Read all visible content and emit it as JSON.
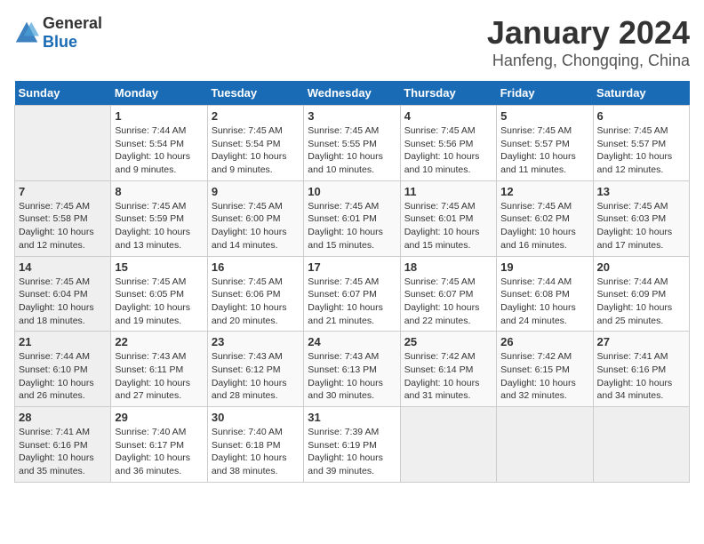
{
  "header": {
    "logo_general": "General",
    "logo_blue": "Blue",
    "month_year": "January 2024",
    "location": "Hanfeng, Chongqing, China"
  },
  "calendar": {
    "days_of_week": [
      "Sunday",
      "Monday",
      "Tuesday",
      "Wednesday",
      "Thursday",
      "Friday",
      "Saturday"
    ],
    "weeks": [
      [
        {
          "day": "",
          "info": ""
        },
        {
          "day": "1",
          "info": "Sunrise: 7:44 AM\nSunset: 5:54 PM\nDaylight: 10 hours\nand 9 minutes."
        },
        {
          "day": "2",
          "info": "Sunrise: 7:45 AM\nSunset: 5:54 PM\nDaylight: 10 hours\nand 9 minutes."
        },
        {
          "day": "3",
          "info": "Sunrise: 7:45 AM\nSunset: 5:55 PM\nDaylight: 10 hours\nand 10 minutes."
        },
        {
          "day": "4",
          "info": "Sunrise: 7:45 AM\nSunset: 5:56 PM\nDaylight: 10 hours\nand 10 minutes."
        },
        {
          "day": "5",
          "info": "Sunrise: 7:45 AM\nSunset: 5:57 PM\nDaylight: 10 hours\nand 11 minutes."
        },
        {
          "day": "6",
          "info": "Sunrise: 7:45 AM\nSunset: 5:57 PM\nDaylight: 10 hours\nand 12 minutes."
        }
      ],
      [
        {
          "day": "7",
          "info": "Sunrise: 7:45 AM\nSunset: 5:58 PM\nDaylight: 10 hours\nand 12 minutes."
        },
        {
          "day": "8",
          "info": "Sunrise: 7:45 AM\nSunset: 5:59 PM\nDaylight: 10 hours\nand 13 minutes."
        },
        {
          "day": "9",
          "info": "Sunrise: 7:45 AM\nSunset: 6:00 PM\nDaylight: 10 hours\nand 14 minutes."
        },
        {
          "day": "10",
          "info": "Sunrise: 7:45 AM\nSunset: 6:01 PM\nDaylight: 10 hours\nand 15 minutes."
        },
        {
          "day": "11",
          "info": "Sunrise: 7:45 AM\nSunset: 6:01 PM\nDaylight: 10 hours\nand 15 minutes."
        },
        {
          "day": "12",
          "info": "Sunrise: 7:45 AM\nSunset: 6:02 PM\nDaylight: 10 hours\nand 16 minutes."
        },
        {
          "day": "13",
          "info": "Sunrise: 7:45 AM\nSunset: 6:03 PM\nDaylight: 10 hours\nand 17 minutes."
        }
      ],
      [
        {
          "day": "14",
          "info": "Sunrise: 7:45 AM\nSunset: 6:04 PM\nDaylight: 10 hours\nand 18 minutes."
        },
        {
          "day": "15",
          "info": "Sunrise: 7:45 AM\nSunset: 6:05 PM\nDaylight: 10 hours\nand 19 minutes."
        },
        {
          "day": "16",
          "info": "Sunrise: 7:45 AM\nSunset: 6:06 PM\nDaylight: 10 hours\nand 20 minutes."
        },
        {
          "day": "17",
          "info": "Sunrise: 7:45 AM\nSunset: 6:07 PM\nDaylight: 10 hours\nand 21 minutes."
        },
        {
          "day": "18",
          "info": "Sunrise: 7:45 AM\nSunset: 6:07 PM\nDaylight: 10 hours\nand 22 minutes."
        },
        {
          "day": "19",
          "info": "Sunrise: 7:44 AM\nSunset: 6:08 PM\nDaylight: 10 hours\nand 24 minutes."
        },
        {
          "day": "20",
          "info": "Sunrise: 7:44 AM\nSunset: 6:09 PM\nDaylight: 10 hours\nand 25 minutes."
        }
      ],
      [
        {
          "day": "21",
          "info": "Sunrise: 7:44 AM\nSunset: 6:10 PM\nDaylight: 10 hours\nand 26 minutes."
        },
        {
          "day": "22",
          "info": "Sunrise: 7:43 AM\nSunset: 6:11 PM\nDaylight: 10 hours\nand 27 minutes."
        },
        {
          "day": "23",
          "info": "Sunrise: 7:43 AM\nSunset: 6:12 PM\nDaylight: 10 hours\nand 28 minutes."
        },
        {
          "day": "24",
          "info": "Sunrise: 7:43 AM\nSunset: 6:13 PM\nDaylight: 10 hours\nand 30 minutes."
        },
        {
          "day": "25",
          "info": "Sunrise: 7:42 AM\nSunset: 6:14 PM\nDaylight: 10 hours\nand 31 minutes."
        },
        {
          "day": "26",
          "info": "Sunrise: 7:42 AM\nSunset: 6:15 PM\nDaylight: 10 hours\nand 32 minutes."
        },
        {
          "day": "27",
          "info": "Sunrise: 7:41 AM\nSunset: 6:16 PM\nDaylight: 10 hours\nand 34 minutes."
        }
      ],
      [
        {
          "day": "28",
          "info": "Sunrise: 7:41 AM\nSunset: 6:16 PM\nDaylight: 10 hours\nand 35 minutes."
        },
        {
          "day": "29",
          "info": "Sunrise: 7:40 AM\nSunset: 6:17 PM\nDaylight: 10 hours\nand 36 minutes."
        },
        {
          "day": "30",
          "info": "Sunrise: 7:40 AM\nSunset: 6:18 PM\nDaylight: 10 hours\nand 38 minutes."
        },
        {
          "day": "31",
          "info": "Sunrise: 7:39 AM\nSunset: 6:19 PM\nDaylight: 10 hours\nand 39 minutes."
        },
        {
          "day": "",
          "info": ""
        },
        {
          "day": "",
          "info": ""
        },
        {
          "day": "",
          "info": ""
        }
      ]
    ]
  }
}
